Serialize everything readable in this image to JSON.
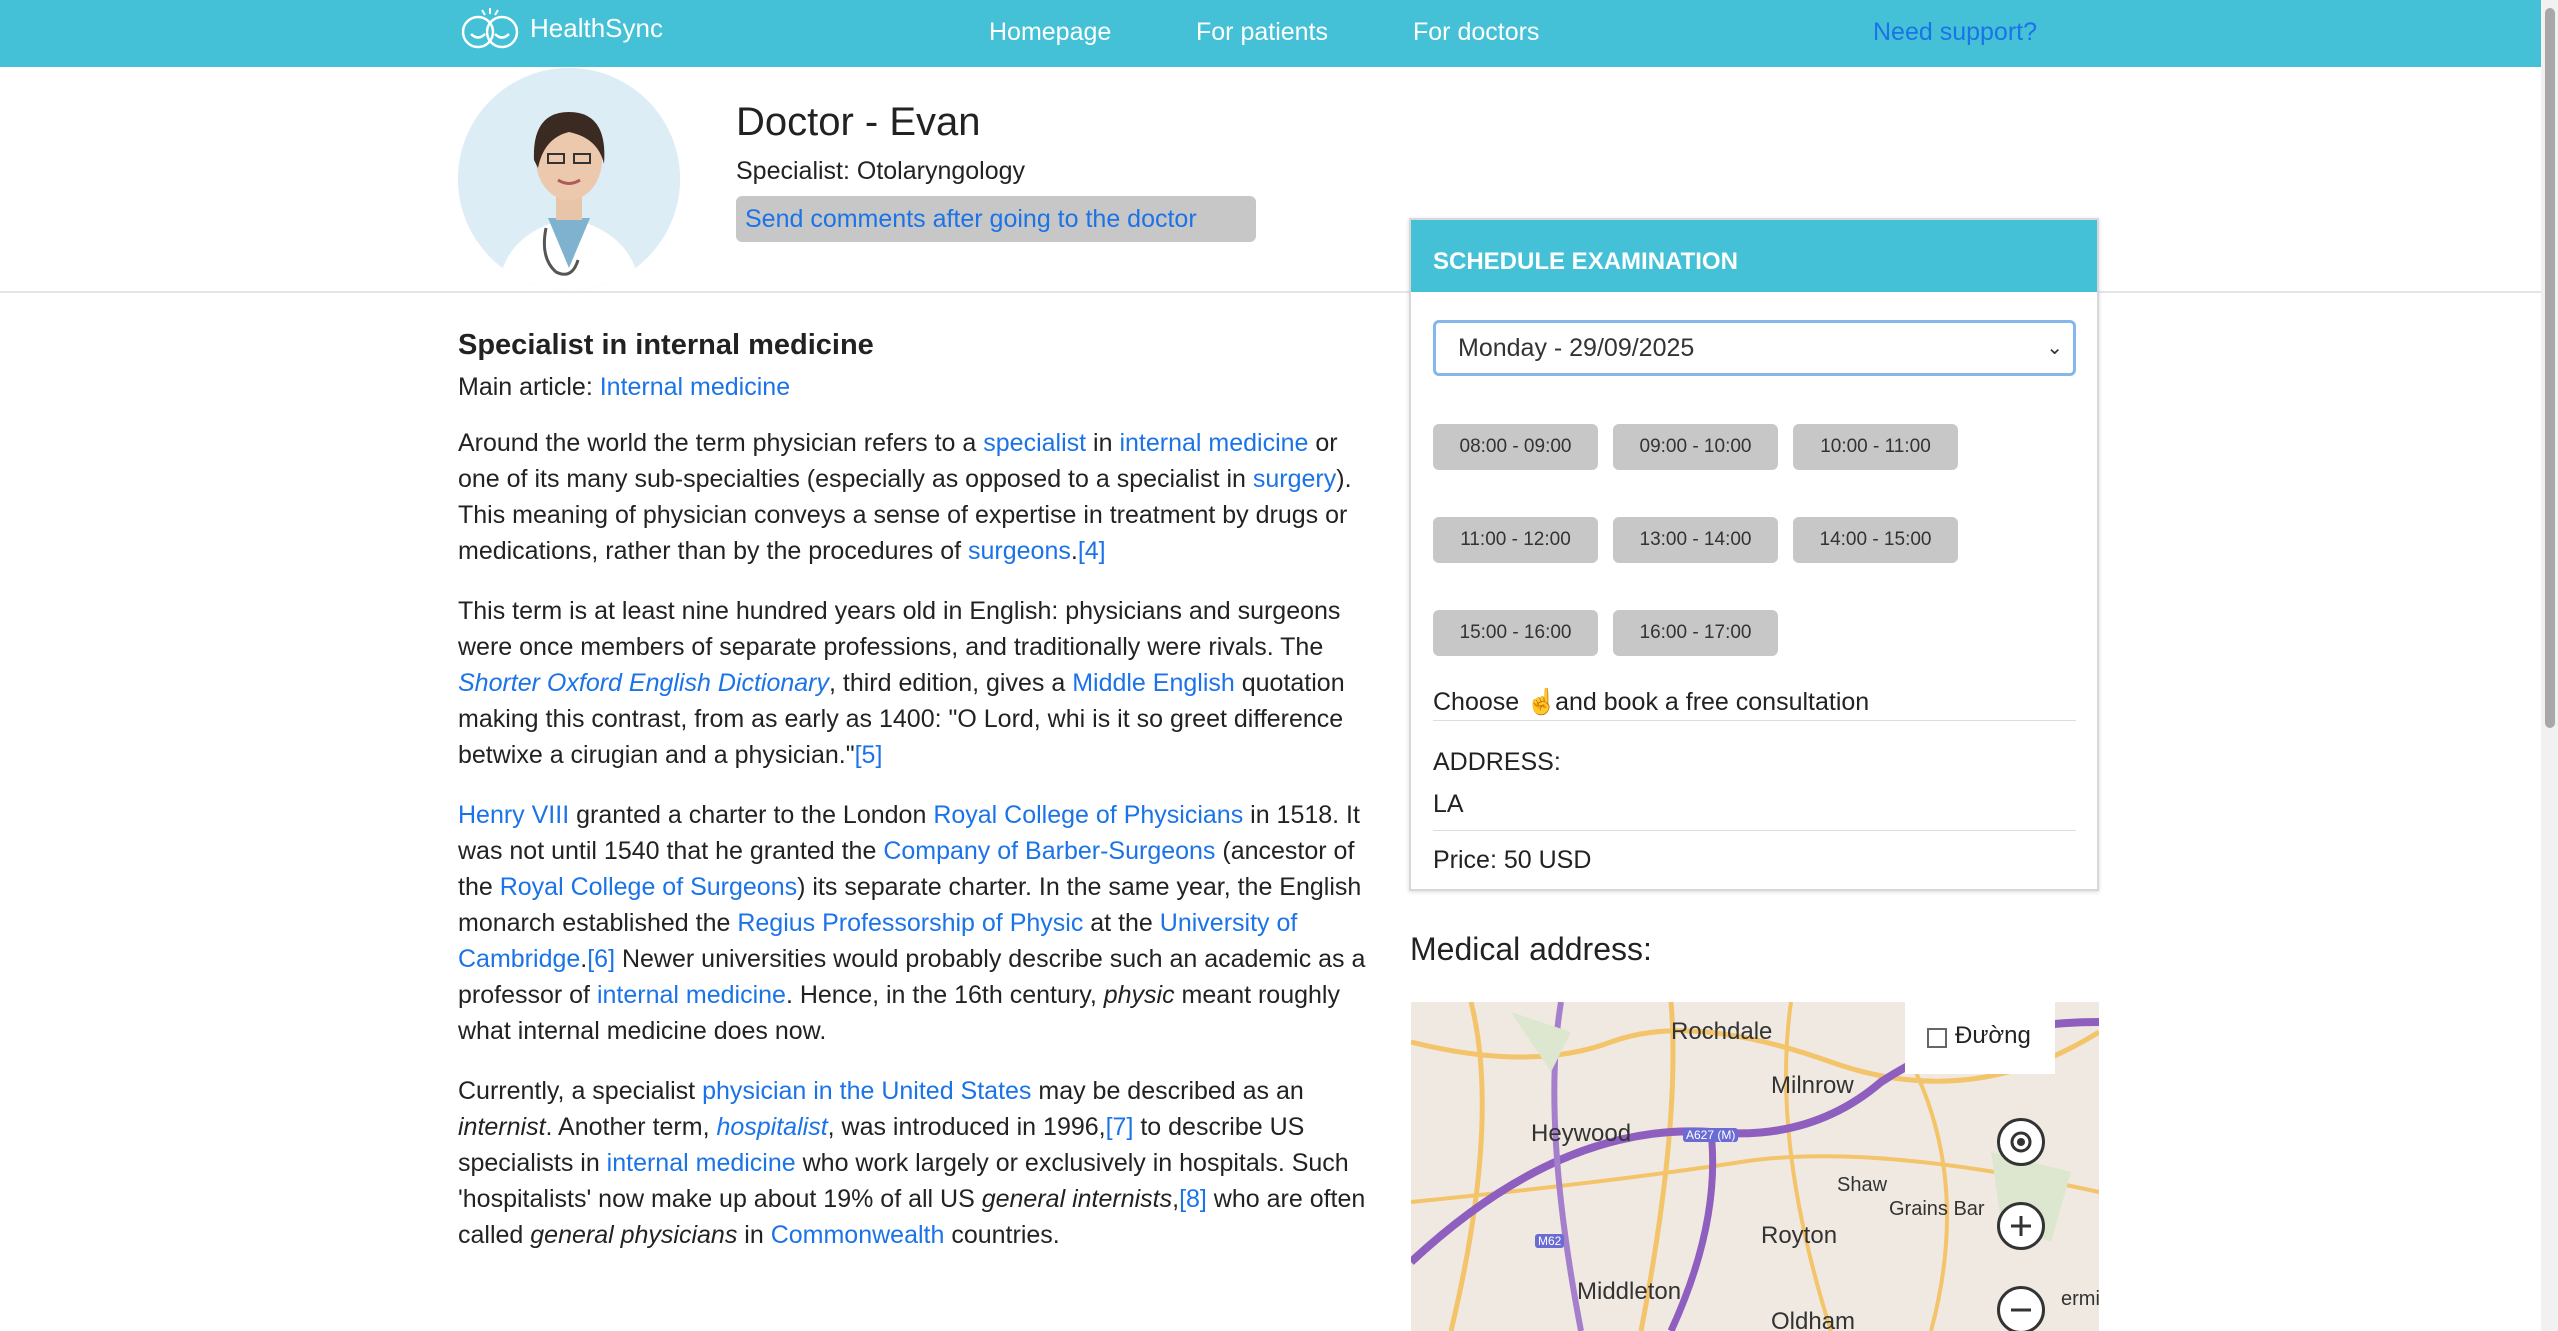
{
  "header": {
    "brand": "HealthSync",
    "nav": [
      "Homepage",
      "For patients",
      "For doctors"
    ],
    "support": "Need support?"
  },
  "doctor": {
    "name": "Doctor - Evan",
    "specialty": "Specialist: Otolaryngology",
    "comment_button": "Send comments after going to the doctor"
  },
  "article": {
    "heading": "Specialist in internal medicine",
    "main_article_prefix": "Main article: ",
    "main_article_link": "Internal medicine"
  },
  "schedule": {
    "title": "SCHEDULE EXAMINATION",
    "selected_date": "Monday - 29/09/2025",
    "slots": [
      "08:00 - 09:00",
      "09:00 - 10:00",
      "10:00 - 11:00",
      "11:00 - 12:00",
      "13:00 - 14:00",
      "14:00 - 15:00",
      "15:00 - 16:00",
      "16:00 - 17:00"
    ],
    "choose_prefix": "Choose",
    "choose_suffix": "and book a free consultation",
    "address_label": "ADDRESS:",
    "address_value": "LA",
    "price": "Price: 50 USD"
  },
  "medical_address": {
    "title": "Medical address:",
    "map_type": "Đường",
    "places": [
      "Rochdale",
      "Milnrow",
      "Heywood",
      "Shaw",
      "Grains Bar",
      "Royton",
      "Middleton",
      "Oldham",
      "ermil"
    ],
    "road_labels": [
      "A627 (M)",
      "M62"
    ]
  },
  "colors": {
    "header_bg": "#44c1d6",
    "link": "#1b73e8",
    "slot_bg": "#c7c7c7"
  }
}
